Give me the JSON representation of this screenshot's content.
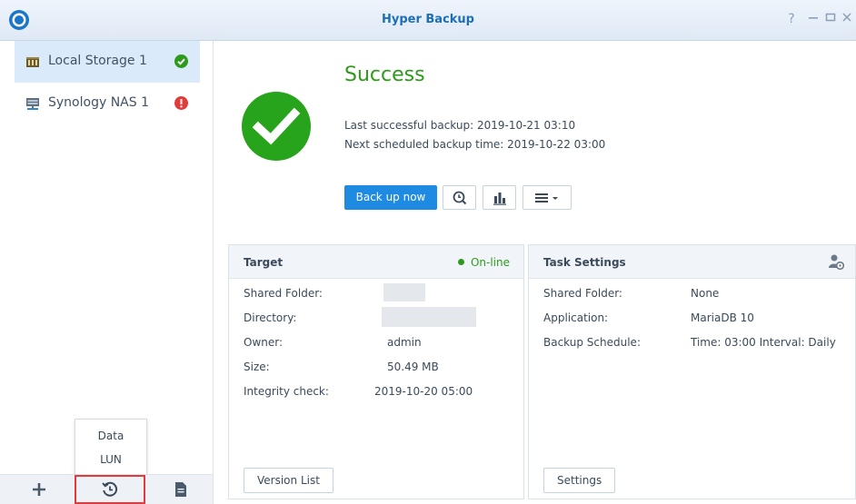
{
  "window": {
    "title": "Hyper Backup"
  },
  "sidebar": {
    "items": [
      {
        "label": "Local Storage 1",
        "icon": "storage-icon",
        "status": "success-icon"
      },
      {
        "label": "Synology NAS 1",
        "icon": "nas-icon",
        "status": "error-icon"
      }
    ]
  },
  "popup_menu": {
    "items": [
      "Data",
      "LUN"
    ]
  },
  "bottom_toolbar": {
    "icons": [
      "plus-icon",
      "restore-icon",
      "log-icon"
    ]
  },
  "status": {
    "title": "Success",
    "last_backup": "Last successful backup: 2019-10-21 03:10",
    "next_backup": "Next scheduled backup time: 2019-10-22 03:00"
  },
  "actions": {
    "backup_now": "Back up now",
    "icons": [
      "version-explorer-icon",
      "statistics-icon",
      "menu-icon"
    ]
  },
  "target_panel": {
    "title": "Target",
    "status": "On-line",
    "rows": [
      {
        "label": "Shared Folder:",
        "value": ""
      },
      {
        "label": "Directory:",
        "value": ""
      },
      {
        "label": "Owner:",
        "value": "admin"
      },
      {
        "label": "Size:",
        "value": "50.49 MB"
      },
      {
        "label": "Integrity check:",
        "value": "2019-10-20 05:00"
      }
    ],
    "button": "Version List"
  },
  "task_panel": {
    "title": "Task Settings",
    "rows": [
      {
        "label": "Shared Folder:",
        "value": "None"
      },
      {
        "label": "Application:",
        "value": "MariaDB 10"
      },
      {
        "label": "Backup Schedule:",
        "value": "Time: 03:00 Interval: Daily"
      }
    ],
    "button": "Settings"
  },
  "colors": {
    "accent": "#1f8ae2",
    "success": "#2e9a1b",
    "error": "#e23b3b",
    "title": "#1d6eb8"
  }
}
